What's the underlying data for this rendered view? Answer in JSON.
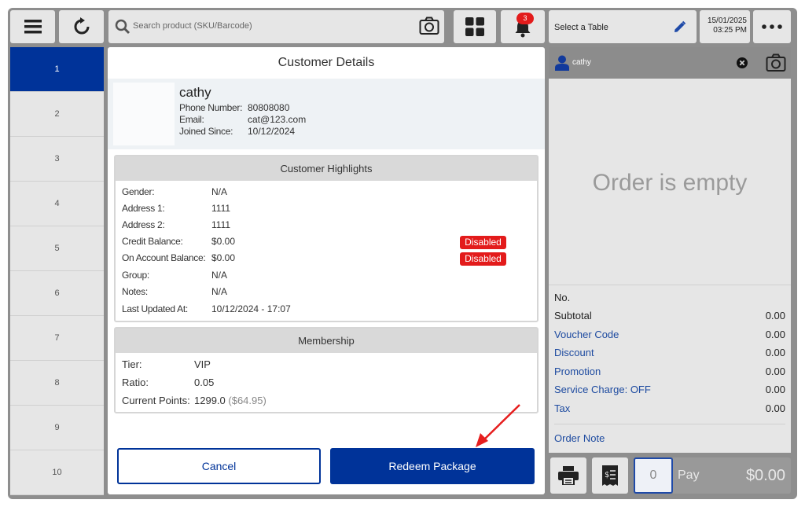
{
  "topbar": {
    "search_placeholder": "Search product (SKU/Barcode)",
    "notification_count": "3",
    "table_select_label": "Select a Table",
    "date": "15/01/2025",
    "time": "03:25 PM"
  },
  "tables": [
    "1",
    "2",
    "3",
    "4",
    "5",
    "6",
    "7",
    "8",
    "9",
    "10"
  ],
  "modal": {
    "title": "Customer Details",
    "customer": {
      "name": "cathy",
      "phone_label": "Phone Number:",
      "phone": "80808080",
      "email_label": "Email:",
      "email": "cat@123.com",
      "joined_label": "Joined Since:",
      "joined": "10/12/2024"
    },
    "highlights": {
      "title": "Customer Highlights",
      "rows": [
        {
          "label": "Gender:",
          "value": "N/A"
        },
        {
          "label": "Address 1:",
          "value": "1111"
        },
        {
          "label": "Address 2:",
          "value": "1111"
        },
        {
          "label": "Credit Balance:",
          "value": "$0.00",
          "badge": "Disabled"
        },
        {
          "label": "On Account Balance:",
          "value": "$0.00",
          "badge": "Disabled"
        },
        {
          "label": "Group:",
          "value": "N/A"
        },
        {
          "label": "Notes:",
          "value": "N/A"
        },
        {
          "label": "Last Updated At:",
          "value": "10/12/2024 - 17:07"
        }
      ]
    },
    "membership": {
      "title": "Membership",
      "tier_label": "Tier:",
      "tier": "VIP",
      "ratio_label": "Ratio:",
      "ratio": "0.05",
      "points_label": "Current Points:",
      "points": "1299.0",
      "points_value": "($64.95)"
    },
    "cancel_label": "Cancel",
    "redeem_label": "Redeem Package"
  },
  "order": {
    "customer_name": "cathy",
    "empty_text": "Order is empty",
    "no_label": "No.",
    "rows": [
      {
        "label": "Subtotal",
        "value": "0.00",
        "link": false
      },
      {
        "label": "Voucher Code",
        "value": "0.00",
        "link": true
      },
      {
        "label": "Discount",
        "value": "0.00",
        "link": true
      },
      {
        "label": "Promotion",
        "value": "0.00",
        "link": true
      },
      {
        "label": "Service Charge: OFF",
        "value": "0.00",
        "link": true
      },
      {
        "label": "Tax",
        "value": "0.00",
        "link": true
      }
    ],
    "order_note_label": "Order Note",
    "qty": "0",
    "pay_label": "Pay",
    "pay_amount": "$0.00"
  },
  "colors": {
    "accent": "#003399",
    "badge_red": "#e31b1b",
    "link_blue": "#1e4ba0",
    "annotation_red": "#e61e1e"
  }
}
